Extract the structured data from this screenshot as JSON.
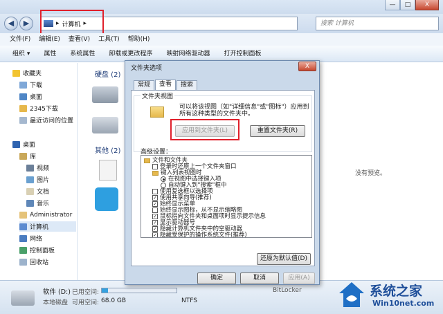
{
  "window": {
    "minimize": "—",
    "maximize": "□",
    "close": "X"
  },
  "address": {
    "path": "计算机",
    "sep1": "▸",
    "sep2": "▸",
    "search_placeholder": "搜索 计算机"
  },
  "nav": {
    "back": "◀",
    "forward": "▶"
  },
  "menu": [
    "文件(F)",
    "编辑(E)",
    "查看(V)",
    "工具(T)",
    "帮助(H)"
  ],
  "toolbar": [
    "组织 ▾",
    "属性",
    "系统属性",
    "卸载或更改程序",
    "映射网络驱动器",
    "打开控制面板"
  ],
  "sidebar": {
    "favorites": "收藏夹",
    "items": [
      "下载",
      "桌面",
      "2345下载",
      "最近访问的位置"
    ],
    "desktop": "桌面",
    "lib": "库",
    "lib_items": [
      "视频",
      "图片",
      "文档",
      "音乐"
    ],
    "admin": "Administrator",
    "computer": "计算机",
    "network": "网络",
    "control_panel": "控制面板",
    "recycle": "回收站"
  },
  "content": {
    "hard_disks": "硬盘 (2)",
    "other": "其他 (2)",
    "no_preview": "没有预览。"
  },
  "status": {
    "drive_name": "软件 (D:)",
    "used_label": "已用空间:",
    "free_label": "可用空间:",
    "free_value": "68.0 GB",
    "type": "本地磁盘",
    "extra1": "BitLocker",
    "extra2": "NTFS"
  },
  "dialog": {
    "title": "文件夹选项",
    "tabs": [
      "常规",
      "查看",
      "搜索"
    ],
    "group_label": "文件夹视图",
    "group_text": "可以将该视图（如\"详细信息\"或\"图标\"）应用到所有这种类型的文件夹中。",
    "apply_folders": "应用到文件夹(L)",
    "reset_folders": "重置文件夹(R)",
    "advanced_label": "高级设置：",
    "advanced_items": [
      {
        "text": "文件和文件夹",
        "kind": "folder"
      },
      {
        "text": "登录时还原上一个文件夹窗口",
        "kind": "cb",
        "checked": false
      },
      {
        "text": "键入列表视图时",
        "kind": "folder"
      },
      {
        "text": "在视图中选择键入项",
        "kind": "rd",
        "checked": true
      },
      {
        "text": "自动键入到\"搜索\"框中",
        "kind": "rd",
        "checked": false
      },
      {
        "text": "使用复选框以选择项",
        "kind": "cb",
        "checked": false
      },
      {
        "text": "使用共享向导(推荐)",
        "kind": "cb",
        "checked": true
      },
      {
        "text": "始终显示菜单",
        "kind": "cb",
        "checked": true
      },
      {
        "text": "始终显示图标，从不显示缩略图",
        "kind": "cb",
        "checked": false
      },
      {
        "text": "鼠标指向文件夹和桌面项时显示提示信息",
        "kind": "cb",
        "checked": true
      },
      {
        "text": "显示驱动器号",
        "kind": "cb",
        "checked": true
      },
      {
        "text": "隐藏计算机文件夹中的空驱动器",
        "kind": "cb",
        "checked": true
      },
      {
        "text": "隐藏受保护的操作系统文件(推荐)",
        "kind": "cb",
        "checked": true
      }
    ],
    "restore_defaults": "还原为默认值(D)",
    "ok": "确定",
    "cancel": "取消",
    "apply": "应用(A)"
  },
  "watermark": {
    "brand": "系统之家",
    "site": "Win10net.com"
  },
  "colors": {
    "highlight": "#e0202b",
    "window": "#cad9ea"
  }
}
